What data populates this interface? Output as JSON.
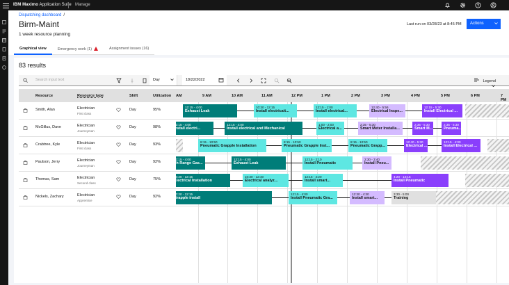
{
  "topbar": {
    "brand_bold": "IBM Maximo",
    "brand_rest": "Application Suite",
    "manage": "Manage"
  },
  "header": {
    "breadcrumb": "Dispatching dashboard",
    "breadcrumb_sep": "/",
    "title": "Birm-Maint",
    "subtitle": "1 week resource planning",
    "last_run": "Last run on 03/28/23 at 8:45 PM",
    "actions_label": "Actions"
  },
  "tabs": [
    {
      "label": "Graphical view"
    },
    {
      "label": "Emergency work (1)"
    },
    {
      "label": "Assignment issues (16)"
    }
  ],
  "results": "83 results",
  "toolbar": {
    "search_placeholder": "Search input text",
    "view": "Day",
    "date": "18/22/2022",
    "legend": "Legend"
  },
  "columns": {
    "resource": "Resource",
    "type": "Resource type",
    "shift": "Shift",
    "util": "Utilization"
  },
  "hours": [
    "AM",
    "9 AM",
    "10 AM",
    "11 AM",
    "12 PM",
    "1 PM",
    "2 PM",
    "3 PM",
    "4 PM",
    "5 PM",
    "6 PM",
    "7 PM"
  ],
  "rows": [
    {
      "name": "Smith, Alan",
      "type": "Electrician",
      "class": "First class",
      "shift": "Day",
      "util": "95%"
    },
    {
      "name": "McGillus, Dave",
      "type": "Electrician",
      "class": "Journeyman",
      "shift": "Day",
      "util": "98%"
    },
    {
      "name": "Crabtree, Kyle",
      "type": "Electrician",
      "class": "First class",
      "shift": "Day",
      "util": "93%"
    },
    {
      "name": "Paulson, Jerry",
      "type": "Electrician",
      "class": "Journeyman",
      "shift": "Day",
      "util": "92%"
    },
    {
      "name": "Thomas, Sam",
      "type": "Electrician",
      "class": "Second class",
      "shift": "Day",
      "util": "75%"
    },
    {
      "name": "Nickels, Zachary",
      "type": "Electrician",
      "class": "Apprentice",
      "shift": "Day",
      "util": "92%"
    }
  ],
  "bars": [
    {
      "time": "12:15 - 4:00",
      "label": "Exhaust Leak"
    },
    {
      "time": "10:30 - 12:15",
      "label": "Install electricait..."
    },
    {
      "time": "12:15 - 1:00",
      "label": "Install electrical..."
    },
    {
      "time": "12:40 - 5:56",
      "label": "Electrical Inspe..."
    },
    {
      "time": "12:15 - 5:30",
      "label": "Install Electrical ..."
    },
    {
      "time": "12:15 - 4:00",
      "label": "Install electri..."
    },
    {
      "time": "12:15 - 4:00",
      "label": "Install electrical and Mechanical"
    },
    {
      "time": "1:00 - 2:00",
      "label": "Electrical a..."
    },
    {
      "time": "2:35 - 5:30",
      "label": "Smart Meter Installa..."
    },
    {
      "time": "2:35 - 5:30",
      "label": "Smart M..."
    },
    {
      "time": "2:35 - 5:30",
      "label": "Pneuma..."
    },
    {
      "time": "8:15 - 10:50",
      "label": "Pneumatic Grapple Installation"
    },
    {
      "time": "8:15 - 10:50",
      "label": "Pneumatic Grapple Inst..."
    },
    {
      "time": "8:15 - 10:50",
      "label": "Pneumatic Grapp..."
    },
    {
      "time": "12:40 - 5:30",
      "label": "Electrical ..."
    },
    {
      "time": "12:15 - 4:00",
      "label": "Install Electrical ..."
    },
    {
      "time": "12:15 - 4:00",
      "label": "gh Range Gas..."
    },
    {
      "time": "12:15 - 4:00",
      "label": "Exhaust Leak"
    },
    {
      "time": "12:15 - 2:10",
      "label": "Install Pneumatic"
    },
    {
      "time": "2:30 - 3:40",
      "label": "Install Pneu..."
    },
    {
      "time": "10:20 - 12:15",
      "label": "Electrical Installation"
    },
    {
      "time": "10:30 - 12:40",
      "label": "Electrical analyz..."
    },
    {
      "time": "12:15 - 2:20",
      "label": "Install smart..."
    },
    {
      "time": "4:20 - 12:15",
      "label": "Install Pneumatic"
    },
    {
      "time": "10:20 - 12:15",
      "label": "Grapple install"
    },
    {
      "time": "12:15 - 4:00",
      "label": "Install Pneumatic Gra..."
    },
    {
      "time": "12:30 - 4:30",
      "label": "Install smart..."
    },
    {
      "time": "3:30 - 5:00",
      "label": "Training"
    }
  ]
}
